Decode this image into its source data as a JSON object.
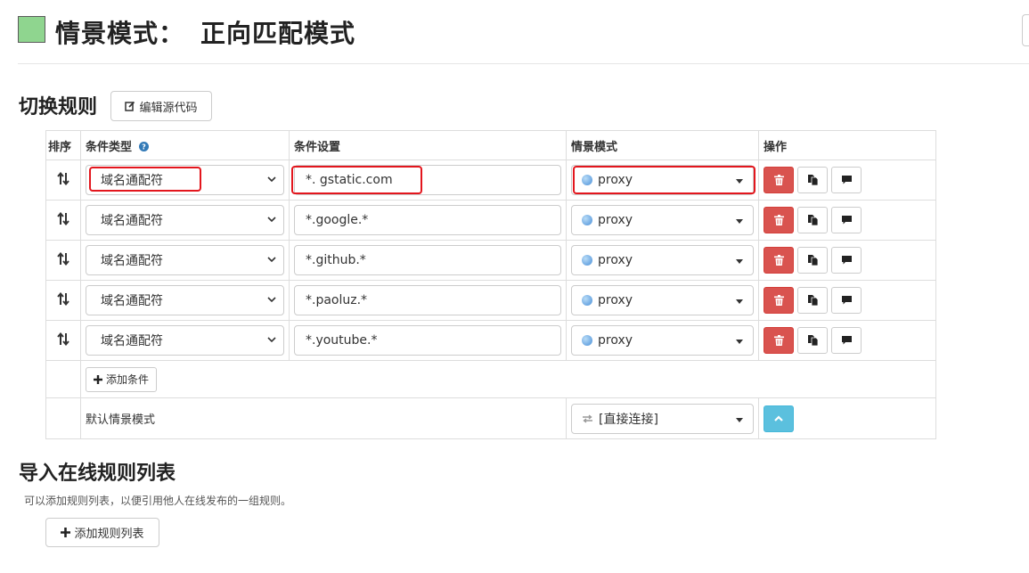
{
  "header": {
    "title_prefix": "情景模式：",
    "profile_name": "正向匹配模式",
    "swatch_color": "#8fd58f"
  },
  "rules_section": {
    "title": "切换规则",
    "edit_source_label": "编辑源代码",
    "columns": {
      "sort": "排序",
      "type": "条件类型",
      "value": "条件设置",
      "profile": "情景模式",
      "ops": "操作"
    },
    "rows": [
      {
        "type": "域名通配符",
        "value": "*. gstatic.com",
        "profile": "proxy"
      },
      {
        "type": "域名通配符",
        "value": "*.google.*",
        "profile": "proxy"
      },
      {
        "type": "域名通配符",
        "value": "*.github.*",
        "profile": "proxy"
      },
      {
        "type": "域名通配符",
        "value": "*.paoluz.*",
        "profile": "proxy"
      },
      {
        "type": "域名通配符",
        "value": "*.youtube.*",
        "profile": "proxy"
      }
    ],
    "add_condition_label": "添加条件",
    "default_label": "默认情景模式",
    "default_profile": "[直接连接]"
  },
  "import_section": {
    "title": "导入在线规则列表",
    "description": "可以添加规则列表，以便引用他人在线发布的一组规则。",
    "add_list_label": "添加规则列表"
  },
  "colors": {
    "danger": "#d9534f",
    "info": "#5bc0de",
    "highlight": "#e3161d"
  }
}
